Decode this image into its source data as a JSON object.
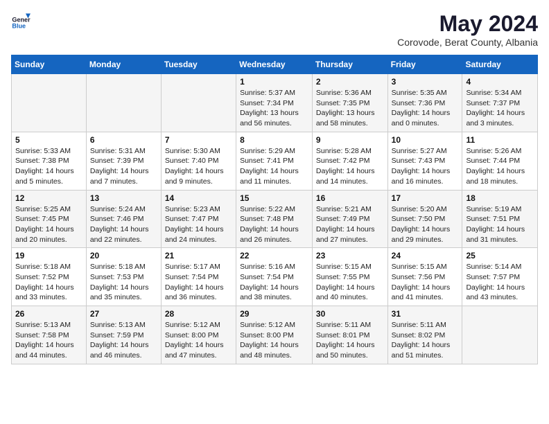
{
  "header": {
    "logo_general": "General",
    "logo_blue": "Blue",
    "month_title": "May 2024",
    "location": "Corovode, Berat County, Albania"
  },
  "days_of_week": [
    "Sunday",
    "Monday",
    "Tuesday",
    "Wednesday",
    "Thursday",
    "Friday",
    "Saturday"
  ],
  "weeks": [
    [
      {
        "day": "",
        "info": ""
      },
      {
        "day": "",
        "info": ""
      },
      {
        "day": "",
        "info": ""
      },
      {
        "day": "1",
        "info": "Sunrise: 5:37 AM\nSunset: 7:34 PM\nDaylight: 13 hours and 56 minutes."
      },
      {
        "day": "2",
        "info": "Sunrise: 5:36 AM\nSunset: 7:35 PM\nDaylight: 13 hours and 58 minutes."
      },
      {
        "day": "3",
        "info": "Sunrise: 5:35 AM\nSunset: 7:36 PM\nDaylight: 14 hours and 0 minutes."
      },
      {
        "day": "4",
        "info": "Sunrise: 5:34 AM\nSunset: 7:37 PM\nDaylight: 14 hours and 3 minutes."
      }
    ],
    [
      {
        "day": "5",
        "info": "Sunrise: 5:33 AM\nSunset: 7:38 PM\nDaylight: 14 hours and 5 minutes."
      },
      {
        "day": "6",
        "info": "Sunrise: 5:31 AM\nSunset: 7:39 PM\nDaylight: 14 hours and 7 minutes."
      },
      {
        "day": "7",
        "info": "Sunrise: 5:30 AM\nSunset: 7:40 PM\nDaylight: 14 hours and 9 minutes."
      },
      {
        "day": "8",
        "info": "Sunrise: 5:29 AM\nSunset: 7:41 PM\nDaylight: 14 hours and 11 minutes."
      },
      {
        "day": "9",
        "info": "Sunrise: 5:28 AM\nSunset: 7:42 PM\nDaylight: 14 hours and 14 minutes."
      },
      {
        "day": "10",
        "info": "Sunrise: 5:27 AM\nSunset: 7:43 PM\nDaylight: 14 hours and 16 minutes."
      },
      {
        "day": "11",
        "info": "Sunrise: 5:26 AM\nSunset: 7:44 PM\nDaylight: 14 hours and 18 minutes."
      }
    ],
    [
      {
        "day": "12",
        "info": "Sunrise: 5:25 AM\nSunset: 7:45 PM\nDaylight: 14 hours and 20 minutes."
      },
      {
        "day": "13",
        "info": "Sunrise: 5:24 AM\nSunset: 7:46 PM\nDaylight: 14 hours and 22 minutes."
      },
      {
        "day": "14",
        "info": "Sunrise: 5:23 AM\nSunset: 7:47 PM\nDaylight: 14 hours and 24 minutes."
      },
      {
        "day": "15",
        "info": "Sunrise: 5:22 AM\nSunset: 7:48 PM\nDaylight: 14 hours and 26 minutes."
      },
      {
        "day": "16",
        "info": "Sunrise: 5:21 AM\nSunset: 7:49 PM\nDaylight: 14 hours and 27 minutes."
      },
      {
        "day": "17",
        "info": "Sunrise: 5:20 AM\nSunset: 7:50 PM\nDaylight: 14 hours and 29 minutes."
      },
      {
        "day": "18",
        "info": "Sunrise: 5:19 AM\nSunset: 7:51 PM\nDaylight: 14 hours and 31 minutes."
      }
    ],
    [
      {
        "day": "19",
        "info": "Sunrise: 5:18 AM\nSunset: 7:52 PM\nDaylight: 14 hours and 33 minutes."
      },
      {
        "day": "20",
        "info": "Sunrise: 5:18 AM\nSunset: 7:53 PM\nDaylight: 14 hours and 35 minutes."
      },
      {
        "day": "21",
        "info": "Sunrise: 5:17 AM\nSunset: 7:54 PM\nDaylight: 14 hours and 36 minutes."
      },
      {
        "day": "22",
        "info": "Sunrise: 5:16 AM\nSunset: 7:54 PM\nDaylight: 14 hours and 38 minutes."
      },
      {
        "day": "23",
        "info": "Sunrise: 5:15 AM\nSunset: 7:55 PM\nDaylight: 14 hours and 40 minutes."
      },
      {
        "day": "24",
        "info": "Sunrise: 5:15 AM\nSunset: 7:56 PM\nDaylight: 14 hours and 41 minutes."
      },
      {
        "day": "25",
        "info": "Sunrise: 5:14 AM\nSunset: 7:57 PM\nDaylight: 14 hours and 43 minutes."
      }
    ],
    [
      {
        "day": "26",
        "info": "Sunrise: 5:13 AM\nSunset: 7:58 PM\nDaylight: 14 hours and 44 minutes."
      },
      {
        "day": "27",
        "info": "Sunrise: 5:13 AM\nSunset: 7:59 PM\nDaylight: 14 hours and 46 minutes."
      },
      {
        "day": "28",
        "info": "Sunrise: 5:12 AM\nSunset: 8:00 PM\nDaylight: 14 hours and 47 minutes."
      },
      {
        "day": "29",
        "info": "Sunrise: 5:12 AM\nSunset: 8:00 PM\nDaylight: 14 hours and 48 minutes."
      },
      {
        "day": "30",
        "info": "Sunrise: 5:11 AM\nSunset: 8:01 PM\nDaylight: 14 hours and 50 minutes."
      },
      {
        "day": "31",
        "info": "Sunrise: 5:11 AM\nSunset: 8:02 PM\nDaylight: 14 hours and 51 minutes."
      },
      {
        "day": "",
        "info": ""
      }
    ]
  ]
}
